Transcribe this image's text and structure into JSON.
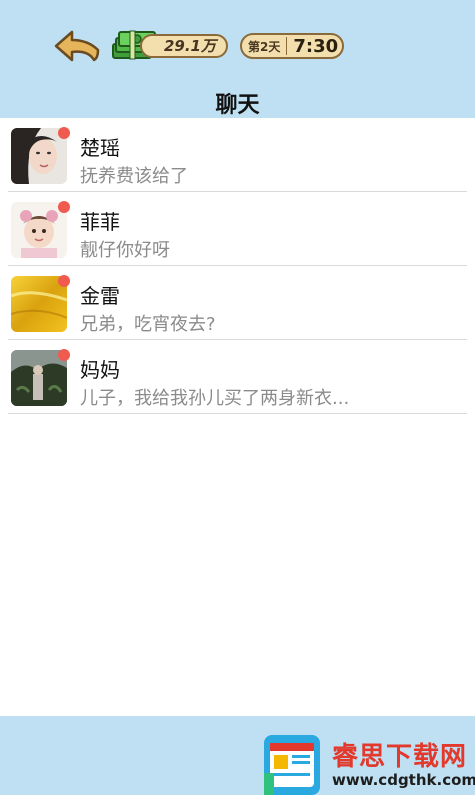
{
  "header": {
    "money": "29.1万",
    "day": "第2天",
    "time": "7:30",
    "title": "聊天"
  },
  "icons": {
    "back": "back-arrow-icon",
    "money": "cash-stack-icon"
  },
  "chats": [
    {
      "name": "楚瑶",
      "preview": "抚养费该给了",
      "unread": true,
      "avatar": "woman-portrait"
    },
    {
      "name": "菲菲",
      "preview": "靓仔你好呀",
      "unread": true,
      "avatar": "child-portrait"
    },
    {
      "name": "金雷",
      "preview": "兄弟，吃宵夜去?",
      "unread": true,
      "avatar": "golden-texture"
    },
    {
      "name": "妈妈",
      "preview": "儿子，我给我孙儿买了两身新衣...",
      "unread": true,
      "avatar": "garden-photo"
    }
  ],
  "watermark": {
    "text": "睿思下载网",
    "url": "www.cdgthk.com"
  },
  "colors": {
    "background": "#bfe0f3",
    "badge": "#f05a4f",
    "pill": "#f3dfae",
    "watermark": "#e2392c"
  }
}
